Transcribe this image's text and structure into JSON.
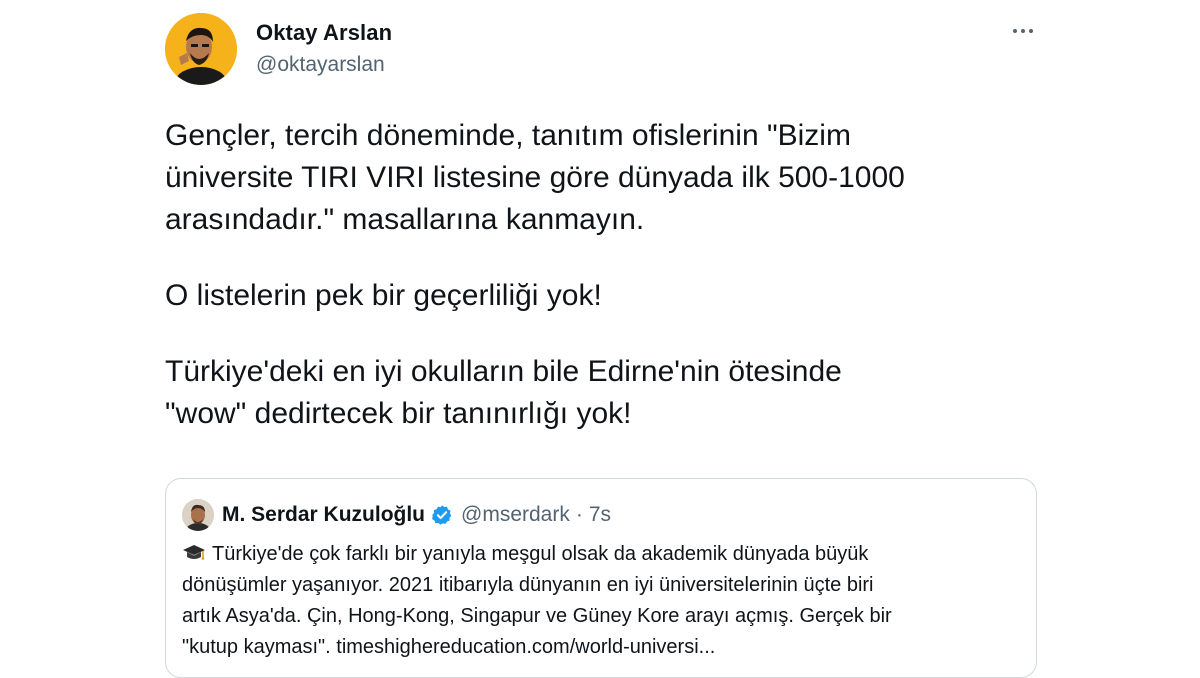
{
  "tweet": {
    "author": {
      "name": "Oktay Arslan",
      "handle": "@oktayarslan",
      "avatar_icon": "user-avatar-photo"
    },
    "more_icon": "more-dots-icon",
    "paragraphs": [
      "Gençler, tercih döneminde, tanıtım ofislerinin \"Bizim\nüniversite TIRI VIRI listesine göre dünyada ilk 500-1000\narasındadır.\" masallarına kanmayın.",
      "O listelerin pek bir geçerliliği yok!",
      "Türkiye'deki en iyi okulların bile Edirne'nin ötesinde\n\"wow\" dedirtecek bir tanınırlığı yok!"
    ]
  },
  "quote": {
    "author": {
      "name": "M. Serdar Kuzuloğlu",
      "handle": "@mserdark",
      "verified": true,
      "avatar_icon": "user-avatar-photo"
    },
    "separator": "·",
    "time": "7s",
    "leading_icon": "graduation-cap-icon",
    "text": "Türkiye'de çok farklı bir yanıyla meşgul olsak da akademik dünyada büyük\ndönüşümler yaşanıyor. 2021 itibarıyla dünyanın en iyi üniversitelerinin üçte biri\nartık Asya'da. Çin, Hong-Kong, Singapur ve Güney Kore arayı açmış. Gerçek bir\n\"kutup kayması\".  timeshighereducation.com/world-universi..."
  },
  "colors": {
    "text_primary": "#0f1419",
    "text_secondary": "#536471",
    "border": "#cfd9de",
    "verified_blue": "#1d9bf0",
    "avatar_bg": "#f6b21b"
  }
}
